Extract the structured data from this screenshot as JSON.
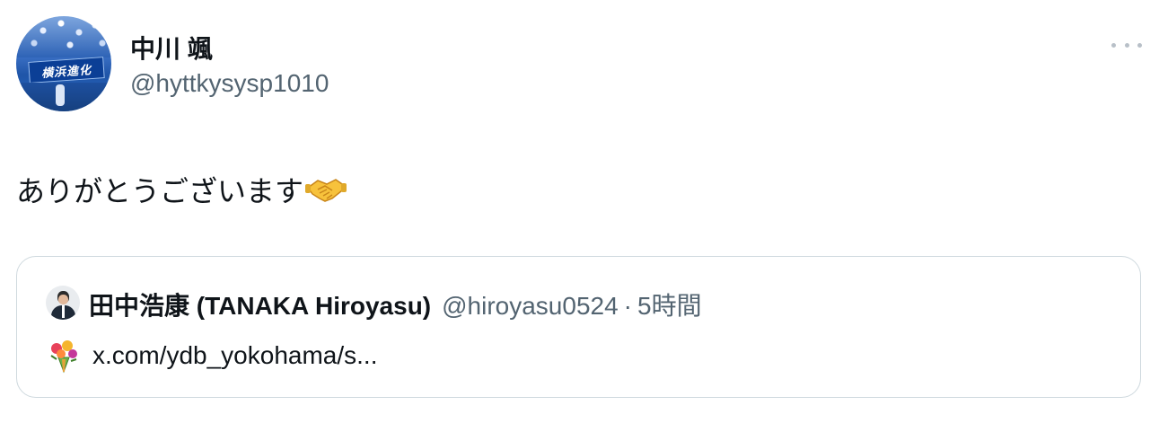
{
  "tweet": {
    "author": {
      "display_name": "中川 颯",
      "handle": "@hyttkysysp1010",
      "avatar_banner_text": "横浜進化"
    },
    "more_icon": "more-horizontal-icon",
    "text": "ありがとうございます",
    "text_emoji": "handshake-emoji"
  },
  "quote": {
    "author": {
      "display_name": "田中浩康 (TANAKA Hiroyasu)",
      "handle": "@hiroyasu0524",
      "separator": "·",
      "time": "5時間"
    },
    "body_emoji": "bouquet-emoji",
    "link_text": "x.com/ydb_yokohama/s..."
  },
  "colors": {
    "text_primary": "#0f1419",
    "text_secondary": "#536471",
    "border": "#cfd9de"
  }
}
